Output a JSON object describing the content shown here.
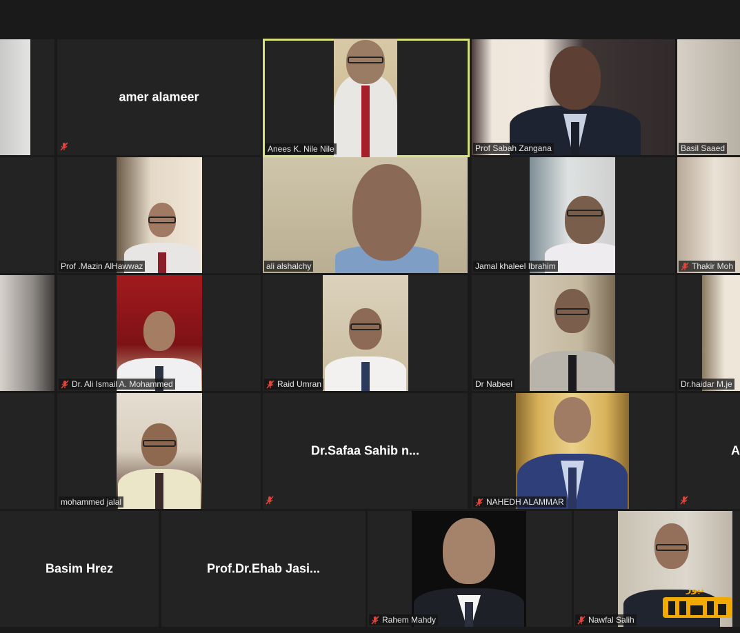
{
  "participants": [
    {
      "name": "amer alameer",
      "muted": true,
      "video": false
    },
    {
      "name": "Anees K. Nile Nile",
      "muted": false,
      "video": true,
      "speaking": true
    },
    {
      "name": "Prof Sabah Zangana",
      "muted": false,
      "video": true
    },
    {
      "name": "Basil Saaed",
      "muted": false,
      "video": true
    },
    {
      "name": "Prof .Mazin AlHawwaz",
      "muted": false,
      "video": true
    },
    {
      "name": "ali alshalchy",
      "muted": false,
      "video": true
    },
    {
      "name": "Jamal khaleel Ibrahim",
      "muted": false,
      "video": true
    },
    {
      "name": "Thakir Moh",
      "muted": true,
      "video": true
    },
    {
      "name": "Dr. Ali Ismail A. Mohammed",
      "muted": true,
      "video": true
    },
    {
      "name": "Raid Umran",
      "muted": true,
      "video": true
    },
    {
      "name": "Dr Nabeel",
      "muted": false,
      "video": true
    },
    {
      "name": "Dr.haidar M.je",
      "muted": false,
      "video": true
    },
    {
      "name": "mohammed jalal",
      "muted": false,
      "video": true
    },
    {
      "name": "Dr.Safaa  Sahib  n...",
      "muted": true,
      "video": false
    },
    {
      "name": "NAHEDH ALAMMAR",
      "muted": true,
      "video": true
    },
    {
      "name": "A",
      "muted": true,
      "video": false
    },
    {
      "name": "Basim Hrez",
      "muted": false,
      "video": false
    },
    {
      "name": "Prof.Dr.Ehab  Jasi...",
      "muted": false,
      "video": false
    },
    {
      "name": "Rahem Mahdy",
      "muted": true,
      "video": true
    },
    {
      "name": "Nawfal Salih",
      "muted": true,
      "video": true
    }
  ],
  "watermark": {
    "text": "نيوز",
    "color": "#f2a900"
  },
  "icons": {
    "mute": "muted-microphone-icon"
  },
  "colors": {
    "active_border": "#d7e27a",
    "mute_red": "#e0443a",
    "tile_bg": "#232323"
  }
}
